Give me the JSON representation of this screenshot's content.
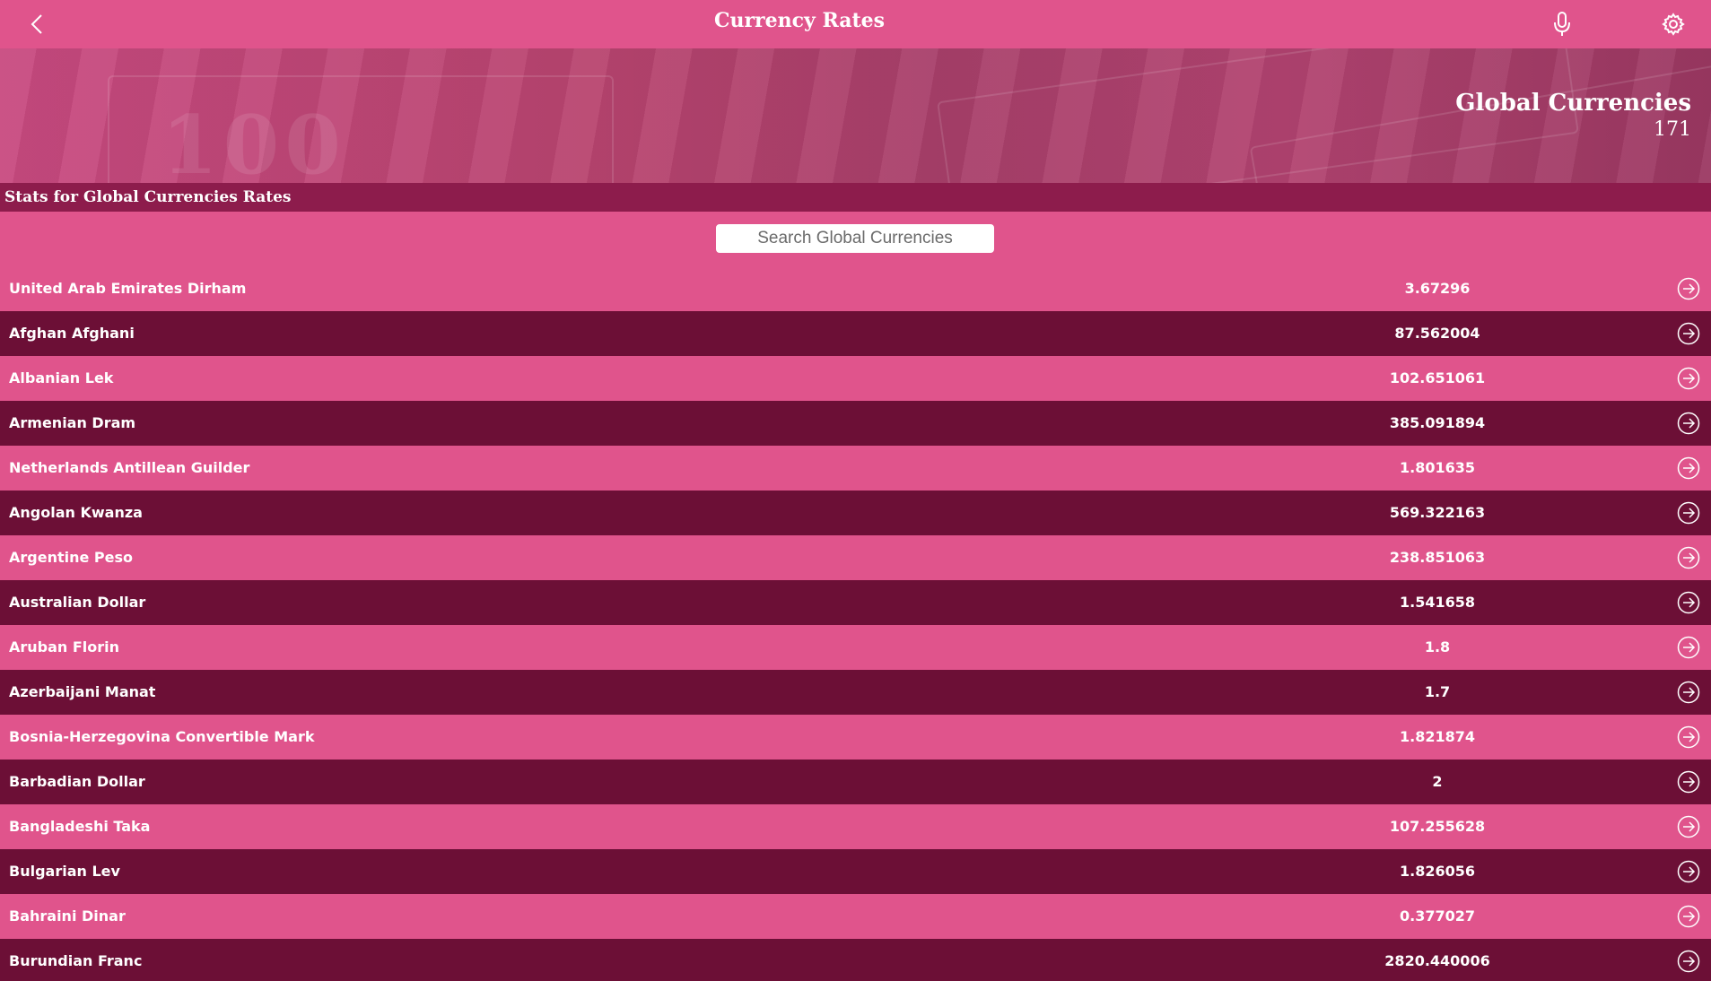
{
  "header": {
    "title": "Currency Rates",
    "back_icon": "chevron-left-icon",
    "mic_icon": "microphone-icon",
    "settings_icon": "gear-icon"
  },
  "banner": {
    "title": "Global Currencies",
    "count": "171"
  },
  "stats_label": "Stats for Global Currencies Rates",
  "search": {
    "placeholder": "Search Global Currencies",
    "value": ""
  },
  "colors": {
    "primary_pink": "#e0548c",
    "dark_maroon": "#6c0f36",
    "stats_strip": "#8d1c4c"
  },
  "currencies": [
    {
      "name": "United Arab Emirates Dirham",
      "rate": "3.67296"
    },
    {
      "name": "Afghan Afghani",
      "rate": "87.562004"
    },
    {
      "name": "Albanian Lek",
      "rate": "102.651061"
    },
    {
      "name": "Armenian Dram",
      "rate": "385.091894"
    },
    {
      "name": "Netherlands Antillean Guilder",
      "rate": "1.801635"
    },
    {
      "name": "Angolan Kwanza",
      "rate": "569.322163"
    },
    {
      "name": "Argentine Peso",
      "rate": "238.851063"
    },
    {
      "name": "Australian Dollar",
      "rate": "1.541658"
    },
    {
      "name": "Aruban Florin",
      "rate": "1.8"
    },
    {
      "name": "Azerbaijani Manat",
      "rate": "1.7"
    },
    {
      "name": "Bosnia-Herzegovina Convertible Mark",
      "rate": "1.821874"
    },
    {
      "name": "Barbadian Dollar",
      "rate": "2"
    },
    {
      "name": "Bangladeshi Taka",
      "rate": "107.255628"
    },
    {
      "name": "Bulgarian Lev",
      "rate": "1.826056"
    },
    {
      "name": "Bahraini Dinar",
      "rate": "0.377027"
    },
    {
      "name": "Burundian Franc",
      "rate": "2820.440006"
    }
  ]
}
